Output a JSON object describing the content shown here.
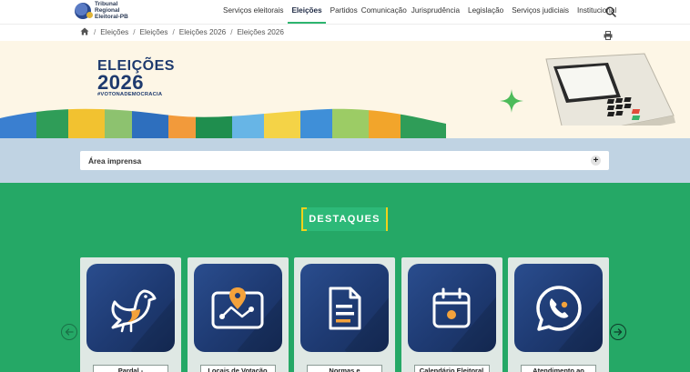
{
  "logo": {
    "line1": "Tribunal",
    "line2": "Regional",
    "line3": "Eleitoral-PB"
  },
  "nav": {
    "items": [
      {
        "label": "Serviços eleitorais",
        "active": false
      },
      {
        "label": "Eleições",
        "active": true
      },
      {
        "label": "Partidos",
        "active": false
      },
      {
        "label": "Comunicação",
        "active": false
      },
      {
        "label": "Jurisprudência",
        "active": false
      },
      {
        "label": "Legislação",
        "active": false
      },
      {
        "label": "Serviços judiciais",
        "active": false
      },
      {
        "label": "Institucional",
        "active": false
      }
    ]
  },
  "breadcrumb": {
    "items": [
      "Eleições",
      "Eleições",
      "Eleições 2026",
      "Eleições 2026"
    ]
  },
  "banner": {
    "title": "ELEIÇÕES",
    "year": "2026",
    "hashtag": "#VOTONADEMOCRACIA"
  },
  "accordion": {
    "label": "Área imprensa",
    "toggle": "+"
  },
  "destaques": {
    "heading": "DESTAQUES",
    "cards": [
      {
        "label": "Pardal -",
        "icon": "bird-icon"
      },
      {
        "label": "Locais de Votação",
        "icon": "map-pin-icon"
      },
      {
        "label": "Normas e",
        "icon": "document-icon"
      },
      {
        "label": "Calendário Eleitoral",
        "icon": "calendar-icon"
      },
      {
        "label": "Atendimento ao",
        "icon": "whatsapp-icon"
      }
    ]
  },
  "colors": {
    "accent_green": "#25a866",
    "navy": "#1e3a6e",
    "orange": "#f4a23b",
    "yellow": "#f1d21a",
    "band_blue": "#c0d3e3"
  }
}
